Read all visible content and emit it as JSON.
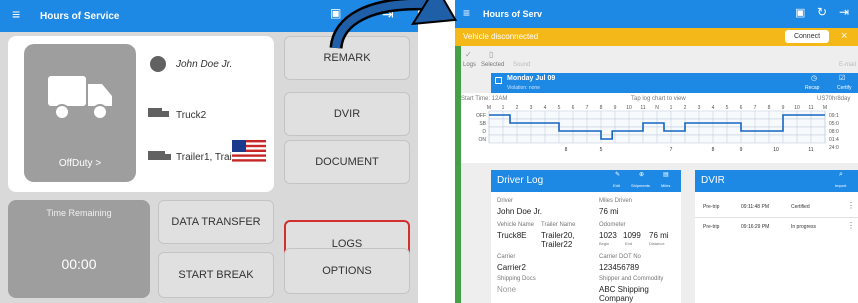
{
  "left": {
    "appbar_title": "Hours of Service",
    "driver_name": "John Doe Jr.",
    "truck": "Truck2",
    "trailers": "Trailer1, Trail...",
    "duty_status": "OffDuty",
    "chevron": ">",
    "time_remaining_label": "Time Remaining",
    "time_remaining_value": "00:00",
    "buttons": {
      "remark": "REMARK",
      "dvir": "DVIR",
      "document": "DOCUMENT",
      "logs": "LOGS",
      "options": "OPTIONS",
      "data_transfer": "DATA TRANSFER",
      "start_break": "START BREAK"
    },
    "colors": {
      "appbar": "#1e88e5",
      "logs_highlight": "#d32f2f"
    }
  },
  "right": {
    "appbar_title": "Hours of Serv",
    "banner_text": "Vehicle disconnected",
    "connect_label": "Connect",
    "close_icon": "×",
    "toolbar": {
      "logs": "Logs",
      "selected": "Selected",
      "sound": "Sound",
      "email": "E-mail"
    },
    "date": "Monday Jul 09",
    "violations": "Violation: none",
    "recap_label": "Recap",
    "certify_label": "Certify",
    "start_time": "Start Time: 12AM",
    "tap_hint": "Tap log chart to view",
    "ruleset": "US70hr8day",
    "status_rows": [
      "OFF",
      "SB",
      "D",
      "ON"
    ],
    "hour_labels": [
      "M",
      "1",
      "2",
      "3",
      "4",
      "5",
      "6",
      "7",
      "8",
      "9",
      "10",
      "11",
      "N",
      "1",
      "2",
      "3",
      "4",
      "5",
      "6",
      "7",
      "8",
      "9",
      "10",
      "11",
      "M"
    ],
    "bottom_labels": [
      "8",
      "5",
      "7",
      "8",
      "9",
      "10",
      "11"
    ],
    "totals": [
      "09:1",
      "05:0",
      "08:0",
      "01:4",
      "24:0"
    ],
    "driver_log": {
      "title": "Driver Log",
      "icons": [
        "Edit",
        "Shipments",
        "Miles"
      ],
      "driver_label": "Driver",
      "driver_value": "John Doe Jr.",
      "miles_label": "Miles Driven",
      "miles_value": "76 mi",
      "vehicle_label": "Vehicle Name",
      "vehicle_value": "Truck8E",
      "trailer_label": "Trailer Name",
      "trailer_value": "Trailer20, Trailer22",
      "odometer_label": "Odometer",
      "odo_begin": "1023",
      "odo_end": "1099",
      "odo_dist": "76 mi",
      "odo_begin_lbl": "Begin",
      "odo_end_lbl": "End",
      "odo_dist_lbl": "Distance",
      "carrier_label": "Carrier",
      "carrier_value": "Carrier2",
      "dot_label": "Carrier DOT No",
      "dot_value": "123456789",
      "shipping_label": "Shipping Docs",
      "shipping_value": "None",
      "shipper_label": "Shipper and Commodity",
      "shipper_value": "ABC Shipping Company"
    },
    "dvir": {
      "title": "DVIR",
      "import_label": "Import",
      "rows": [
        {
          "type": "Pre-trip",
          "time": "09:11:48 PM",
          "status": "Certified"
        },
        {
          "type": "Pre-trip",
          "time": "09:16:29 PM",
          "status": "In progress"
        }
      ]
    },
    "colors": {
      "banner": "#f5b819",
      "appbar": "#1e88e5",
      "log_line": "#1565c0"
    }
  },
  "arrow_color": "#1f5fa8"
}
